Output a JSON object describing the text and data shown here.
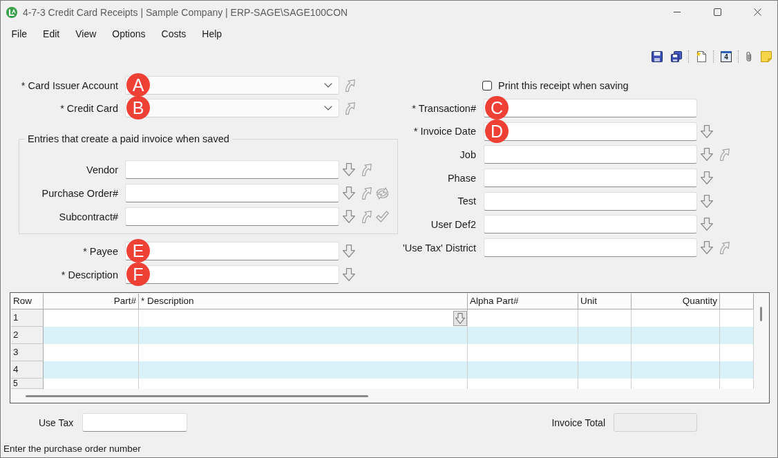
{
  "window": {
    "title": "4-7-3 Credit Card Receipts | Sample Company | ERP-SAGE\\SAGE100CON"
  },
  "menu": [
    "File",
    "Edit",
    "View",
    "Options",
    "Costs",
    "Help"
  ],
  "toolbar": {
    "calendar_day": "4"
  },
  "card_fields": [
    {
      "label": "* Card Issuer Account",
      "kind": "dropdown",
      "marker": "A",
      "actions": [
        {
          "kind": "jump"
        }
      ]
    },
    {
      "label": "* Credit Card",
      "kind": "dropdown",
      "marker": "B",
      "actions": [
        {
          "kind": "jump"
        }
      ]
    }
  ],
  "paid_invoice_group": {
    "title": "Entries that create a paid invoice when saved",
    "fields": [
      {
        "label": "Vendor",
        "kind": "text",
        "actions": [
          {
            "kind": "lookup"
          },
          {
            "kind": "jump"
          }
        ]
      },
      {
        "label": "Purchase Order#",
        "kind": "text",
        "actions": [
          {
            "kind": "lookup"
          },
          {
            "kind": "jump"
          },
          {
            "kind": "refresh"
          }
        ]
      },
      {
        "label": "Subcontract#",
        "kind": "text",
        "actions": [
          {
            "kind": "lookup"
          },
          {
            "kind": "jump"
          },
          {
            "kind": "check"
          }
        ]
      }
    ]
  },
  "payee_fields": [
    {
      "label": "* Payee",
      "kind": "text",
      "marker": "E",
      "actions": [
        {
          "kind": "lookup"
        }
      ]
    },
    {
      "label": "* Description",
      "kind": "text",
      "marker": "F",
      "actions": [
        {
          "kind": "lookup"
        }
      ]
    }
  ],
  "print_option": {
    "label": "Print this receipt when saving",
    "checked": false
  },
  "right_fields": [
    {
      "label": "* Transaction#",
      "kind": "text",
      "marker": "C"
    },
    {
      "label": "* Invoice Date",
      "kind": "text",
      "marker": "D",
      "actions": [
        {
          "kind": "lookup"
        }
      ]
    },
    {
      "label": "Job",
      "kind": "text",
      "actions": [
        {
          "kind": "lookup"
        },
        {
          "kind": "jump"
        }
      ]
    },
    {
      "label": "Phase",
      "kind": "text",
      "actions": [
        {
          "kind": "lookup"
        }
      ]
    },
    {
      "label": "Test",
      "kind": "text",
      "actions": [
        {
          "kind": "lookup"
        }
      ]
    },
    {
      "label": "User Def2",
      "kind": "text",
      "actions": [
        {
          "kind": "lookup"
        }
      ]
    },
    {
      "label": "'Use Tax' District",
      "kind": "text",
      "actions": [
        {
          "kind": "lookup"
        },
        {
          "kind": "jump"
        }
      ]
    }
  ],
  "line_items": {
    "columns": [
      "Row",
      "Part#",
      "* Description",
      "Alpha Part#",
      "Unit",
      "Quantity"
    ],
    "rows": [
      {
        "row": "1",
        "active": true
      },
      {
        "row": "2",
        "active": false
      },
      {
        "row": "3",
        "active": false
      },
      {
        "row": "4",
        "active": false
      },
      {
        "row": "5",
        "active": false
      }
    ]
  },
  "totals": {
    "use_tax": {
      "label": "Use Tax",
      "disabled": false
    },
    "invoice_total": {
      "label": "Invoice Total",
      "disabled": true
    }
  },
  "status_bar": "Enter the purchase order number"
}
